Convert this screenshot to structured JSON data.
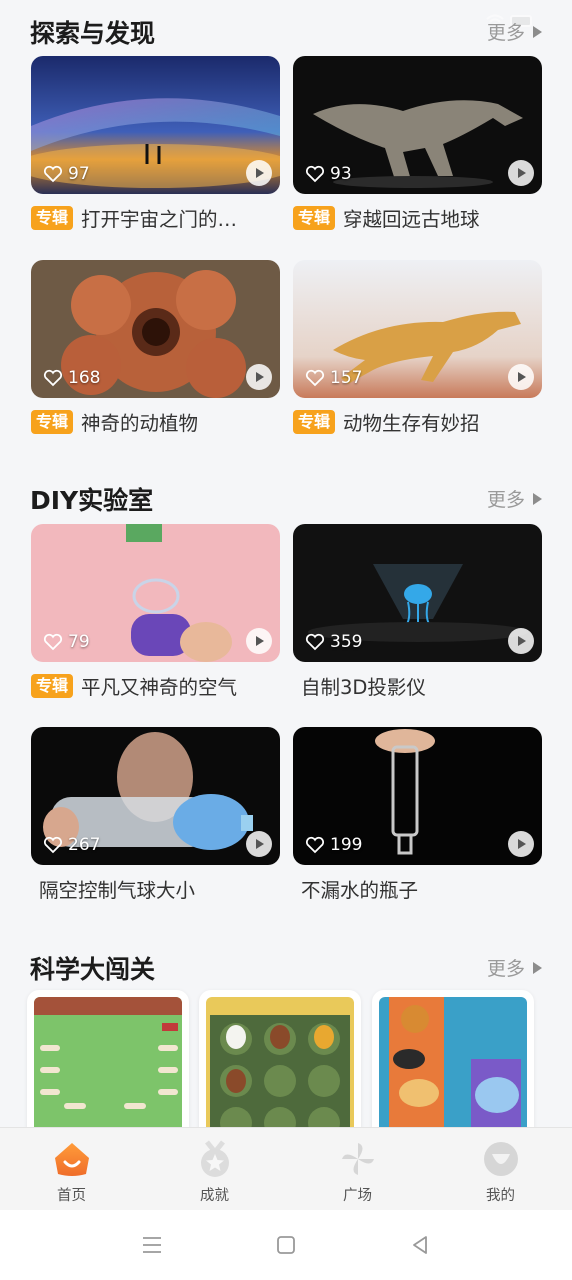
{
  "colors": {
    "accent": "#f7a21c",
    "background": "#f5f6f8",
    "tab_active": "#f08a2a"
  },
  "sections": [
    {
      "title": "探索与发现",
      "more": "更多",
      "cards": [
        {
          "likes": "97",
          "tag": "专辑",
          "title": "打开宇宙之门的…"
        },
        {
          "likes": "93",
          "tag": "专辑",
          "title": "穿越回远古地球"
        },
        {
          "likes": "168",
          "tag": "专辑",
          "title": "神奇的动植物"
        },
        {
          "likes": "157",
          "tag": "专辑",
          "title": "动物生存有妙招"
        }
      ]
    },
    {
      "title": "DIY实验室",
      "more": "更多",
      "cards": [
        {
          "likes": "79",
          "tag": "专辑",
          "title": "平凡又神奇的空气"
        },
        {
          "likes": "359",
          "tag": "",
          "title": "自制3D投影仪"
        },
        {
          "likes": "267",
          "tag": "",
          "title": "隔空控制气球大小"
        },
        {
          "likes": "199",
          "tag": "",
          "title": "不漏水的瓶子"
        }
      ]
    },
    {
      "title": "科学大闯关",
      "more": "更多"
    }
  ],
  "tabbar": [
    {
      "label": "首页",
      "icon": "home-icon"
    },
    {
      "label": "成就",
      "icon": "medal-icon"
    },
    {
      "label": "广场",
      "icon": "pinwheel-icon"
    },
    {
      "label": "我的",
      "icon": "profile-icon"
    }
  ],
  "system_nav": [
    "menu-icon",
    "home-square-icon",
    "back-icon"
  ]
}
